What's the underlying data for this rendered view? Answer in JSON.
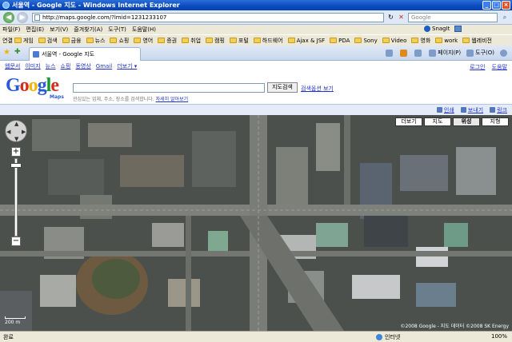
{
  "window": {
    "title": "서울역 - Google 지도 - Windows Internet Explorer"
  },
  "address": {
    "url": "http://maps.google.com/?lmid=1231233107",
    "search_placeholder": "Google"
  },
  "menu": [
    "파일(F)",
    "편집(E)",
    "보기(V)",
    "즐겨찾기(A)",
    "도구(T)",
    "도움말(H)"
  ],
  "snagit_label": "SnagIt",
  "links": {
    "label": "연결",
    "items": [
      "게임",
      "검색",
      "금융",
      "뉴스",
      "쇼핑",
      "영어",
      "증권",
      "취업",
      "캠핑",
      "포털",
      "하드웨어",
      "Ajax & JSF",
      "PDA",
      "Sony",
      "Video",
      "영화",
      "work",
      "웹레비전"
    ]
  },
  "tab": {
    "label": "서울역 - Google 지도"
  },
  "tools": [
    "페이지(P)",
    "도구(O)"
  ],
  "gnav": {
    "items": [
      "웹문서",
      "이미지",
      "뉴스",
      "쇼핑",
      "동영상",
      "Gmail",
      "더보기 ▾"
    ],
    "right": [
      "로그인",
      "도움말"
    ]
  },
  "logo": {
    "sub": "Maps"
  },
  "search": {
    "button": "지도검색",
    "options": "검색옵션 보기",
    "hint": "관심있는 업체, 주소, 장소를 검색합니다.",
    "hint_link": "자세히 알아보기"
  },
  "map_toolbar": [
    "인쇄",
    "보내기",
    "링크"
  ],
  "map": {
    "types": [
      "더보기",
      "지도",
      "위성",
      "지형"
    ],
    "active_type": "위성",
    "scale": "200 m",
    "copyright": "©2008 Google - 지도 데이터 ©2008 SK Energy"
  },
  "status": {
    "left": "완료",
    "zone": "인터넷",
    "zoom": "100%"
  }
}
